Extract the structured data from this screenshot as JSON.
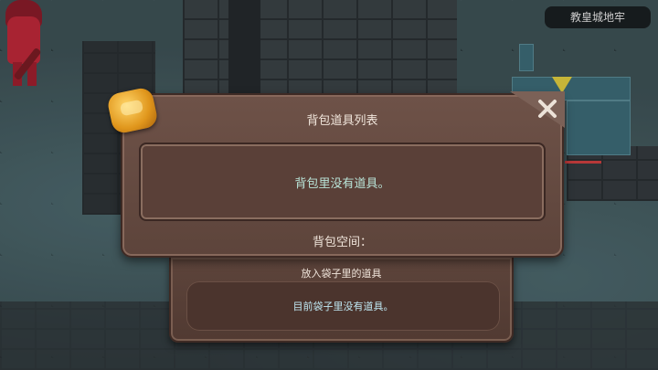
{
  "location": "教皇城地牢",
  "inventory_dialog": {
    "title": "背包道具列表",
    "empty_message": "背包里没有道具。",
    "space_label": "背包空间：",
    "close_icon": "close-icon"
  },
  "bag_section": {
    "label": "放入袋子里的道具",
    "empty_message": "目前袋子里没有道具。"
  },
  "colors": {
    "panel": "#6e5248",
    "empty_text": "#b9e4d8",
    "gem": "#e0961c"
  }
}
